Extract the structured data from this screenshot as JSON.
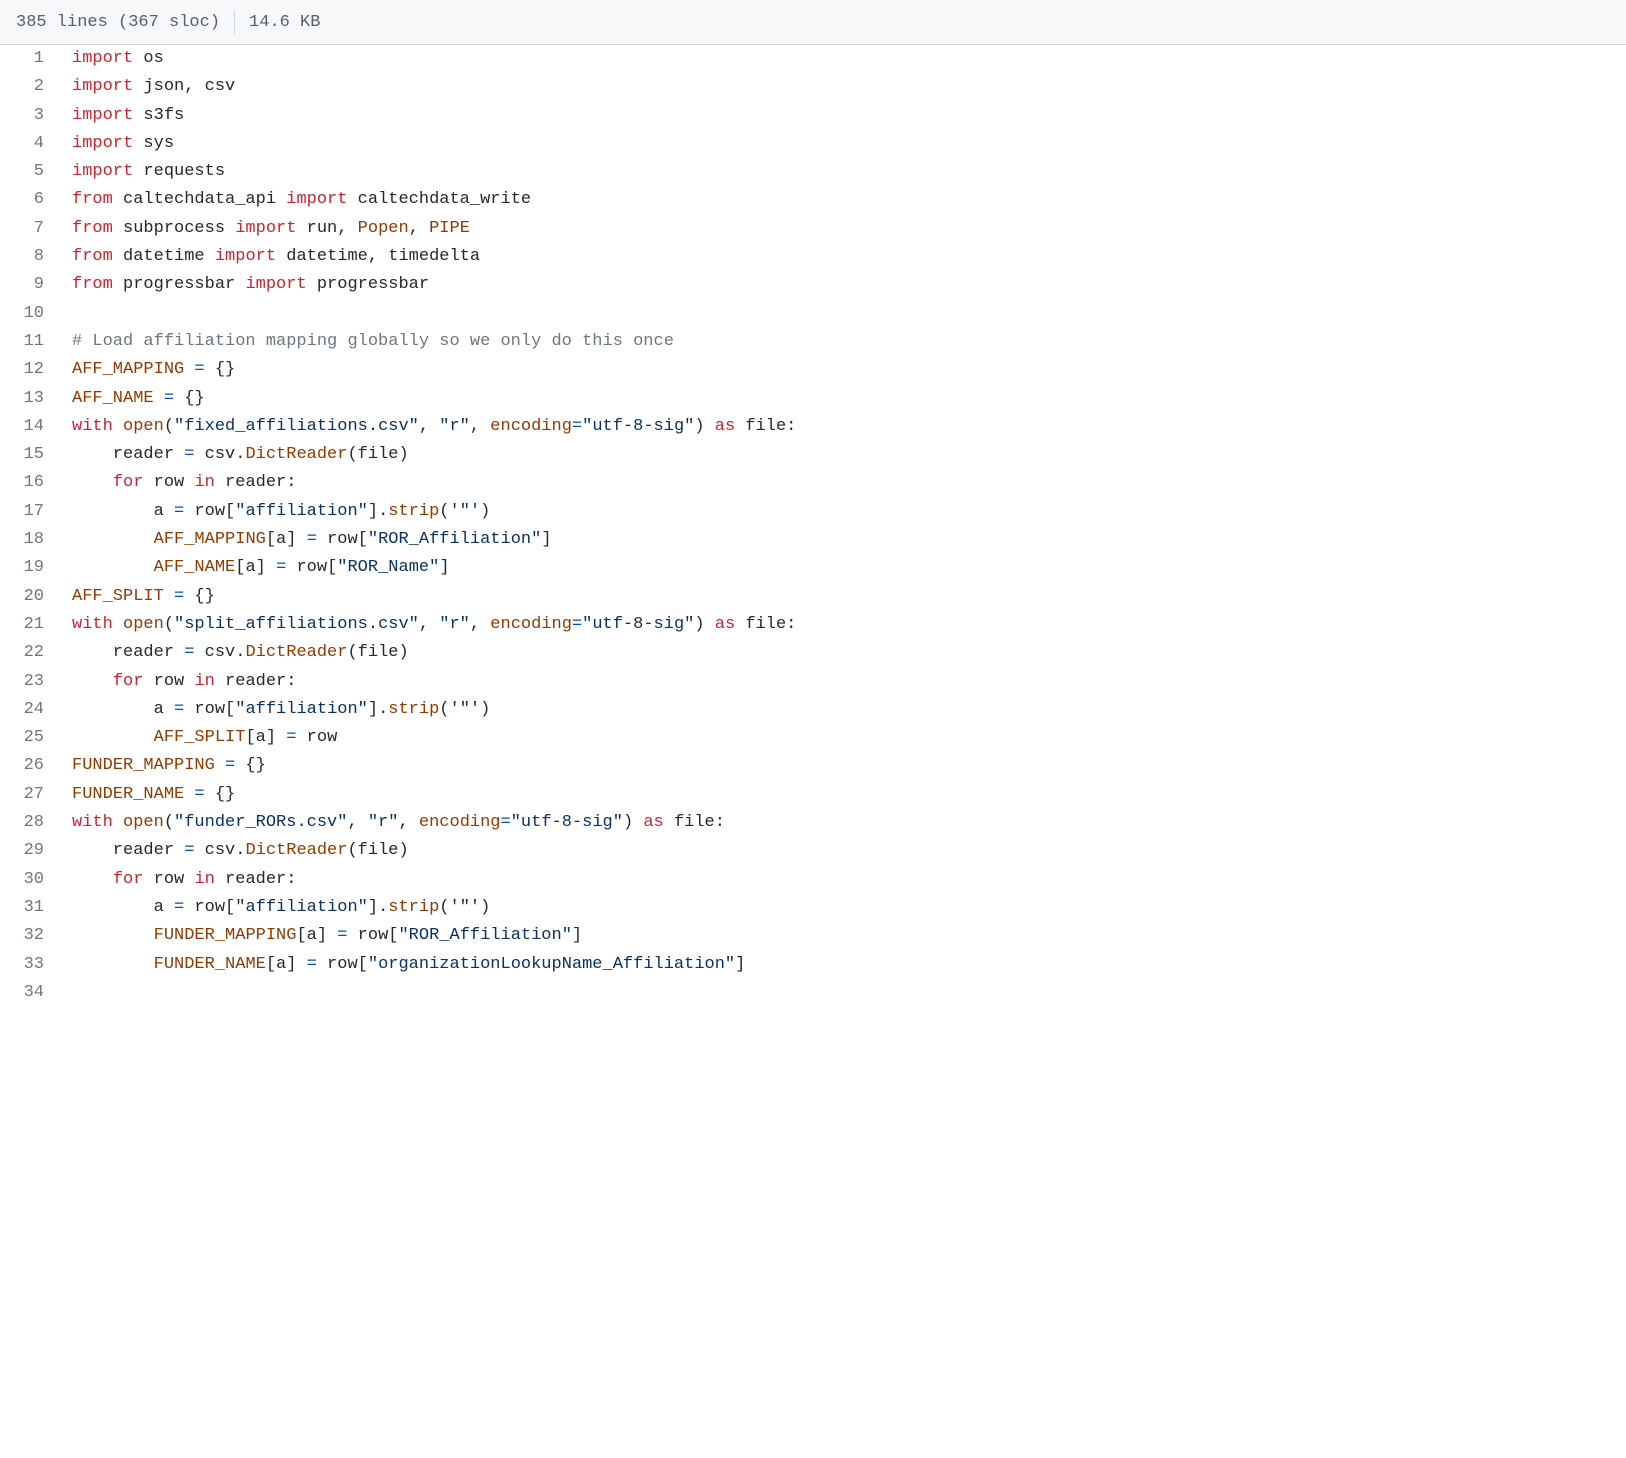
{
  "header": {
    "lines": "385 lines (367 sloc)",
    "size": "14.6 KB"
  },
  "code": [
    {
      "n": 1,
      "t": [
        [
          "kw",
          "import"
        ],
        [
          "nm",
          " os"
        ]
      ]
    },
    {
      "n": 2,
      "t": [
        [
          "kw",
          "import"
        ],
        [
          "nm",
          " json, csv"
        ]
      ]
    },
    {
      "n": 3,
      "t": [
        [
          "kw",
          "import"
        ],
        [
          "nm",
          " s3fs"
        ]
      ]
    },
    {
      "n": 4,
      "t": [
        [
          "kw",
          "import"
        ],
        [
          "nm",
          " sys"
        ]
      ]
    },
    {
      "n": 5,
      "t": [
        [
          "kw",
          "import"
        ],
        [
          "nm",
          " requests"
        ]
      ]
    },
    {
      "n": 6,
      "t": [
        [
          "kw",
          "from"
        ],
        [
          "nm",
          " caltechdata_api "
        ],
        [
          "kw",
          "import"
        ],
        [
          "nm",
          " caltechdata_write"
        ]
      ]
    },
    {
      "n": 7,
      "t": [
        [
          "kw",
          "from"
        ],
        [
          "nm",
          " subprocess "
        ],
        [
          "kw",
          "import"
        ],
        [
          "nm",
          " run, "
        ],
        [
          "var",
          "Popen"
        ],
        [
          "nm",
          ", "
        ],
        [
          "var",
          "PIPE"
        ]
      ]
    },
    {
      "n": 8,
      "t": [
        [
          "kw",
          "from"
        ],
        [
          "nm",
          " datetime "
        ],
        [
          "kw",
          "import"
        ],
        [
          "nm",
          " datetime, timedelta"
        ]
      ]
    },
    {
      "n": 9,
      "t": [
        [
          "kw",
          "from"
        ],
        [
          "nm",
          " progressbar "
        ],
        [
          "kw",
          "import"
        ],
        [
          "nm",
          " progressbar"
        ]
      ]
    },
    {
      "n": 10,
      "t": []
    },
    {
      "n": 11,
      "t": [
        [
          "cm",
          "# Load affiliation mapping globally so we only do this once"
        ]
      ]
    },
    {
      "n": 12,
      "t": [
        [
          "var",
          "AFF_MAPPING"
        ],
        [
          "nm",
          " "
        ],
        [
          "op-blue",
          "="
        ],
        [
          "nm",
          " {}"
        ]
      ]
    },
    {
      "n": 13,
      "t": [
        [
          "var",
          "AFF_NAME"
        ],
        [
          "nm",
          " "
        ],
        [
          "op-blue",
          "="
        ],
        [
          "nm",
          " {}"
        ]
      ]
    },
    {
      "n": 14,
      "t": [
        [
          "kw",
          "with"
        ],
        [
          "nm",
          " "
        ],
        [
          "fn",
          "open"
        ],
        [
          "nm",
          "("
        ],
        [
          "str",
          "\"fixed_affiliations.csv\""
        ],
        [
          "nm",
          ", "
        ],
        [
          "str",
          "\"r\""
        ],
        [
          "nm",
          ", "
        ],
        [
          "var",
          "encoding"
        ],
        [
          "op-blue",
          "="
        ],
        [
          "str",
          "\"utf-8-sig\""
        ],
        [
          "nm",
          ") "
        ],
        [
          "kw",
          "as"
        ],
        [
          "nm",
          " file:"
        ]
      ]
    },
    {
      "n": 15,
      "t": [
        [
          "nm",
          "    reader "
        ],
        [
          "op-blue",
          "="
        ],
        [
          "nm",
          " csv."
        ],
        [
          "fn",
          "DictReader"
        ],
        [
          "nm",
          "(file)"
        ]
      ]
    },
    {
      "n": 16,
      "t": [
        [
          "nm",
          "    "
        ],
        [
          "kw",
          "for"
        ],
        [
          "nm",
          " row "
        ],
        [
          "kw",
          "in"
        ],
        [
          "nm",
          " reader:"
        ]
      ]
    },
    {
      "n": 17,
      "t": [
        [
          "nm",
          "        a "
        ],
        [
          "op-blue",
          "="
        ],
        [
          "nm",
          " row["
        ],
        [
          "str",
          "\"affiliation\""
        ],
        [
          "nm",
          "]."
        ],
        [
          "fn",
          "strip"
        ],
        [
          "nm",
          "("
        ],
        [
          "str",
          "'\"'"
        ],
        [
          "nm",
          ")"
        ]
      ]
    },
    {
      "n": 18,
      "t": [
        [
          "nm",
          "        "
        ],
        [
          "var",
          "AFF_MAPPING"
        ],
        [
          "nm",
          "[a] "
        ],
        [
          "op-blue",
          "="
        ],
        [
          "nm",
          " row["
        ],
        [
          "str",
          "\"ROR_Affiliation\""
        ],
        [
          "nm",
          "]"
        ]
      ]
    },
    {
      "n": 19,
      "t": [
        [
          "nm",
          "        "
        ],
        [
          "var",
          "AFF_NAME"
        ],
        [
          "nm",
          "[a] "
        ],
        [
          "op-blue",
          "="
        ],
        [
          "nm",
          " row["
        ],
        [
          "str",
          "\"ROR_Name\""
        ],
        [
          "nm",
          "]"
        ]
      ]
    },
    {
      "n": 20,
      "t": [
        [
          "var",
          "AFF_SPLIT"
        ],
        [
          "nm",
          " "
        ],
        [
          "op-blue",
          "="
        ],
        [
          "nm",
          " {}"
        ]
      ]
    },
    {
      "n": 21,
      "t": [
        [
          "kw",
          "with"
        ],
        [
          "nm",
          " "
        ],
        [
          "fn",
          "open"
        ],
        [
          "nm",
          "("
        ],
        [
          "str",
          "\"split_affiliations.csv\""
        ],
        [
          "nm",
          ", "
        ],
        [
          "str",
          "\"r\""
        ],
        [
          "nm",
          ", "
        ],
        [
          "var",
          "encoding"
        ],
        [
          "op-blue",
          "="
        ],
        [
          "str",
          "\"utf-8-sig\""
        ],
        [
          "nm",
          ") "
        ],
        [
          "kw",
          "as"
        ],
        [
          "nm",
          " file:"
        ]
      ]
    },
    {
      "n": 22,
      "t": [
        [
          "nm",
          "    reader "
        ],
        [
          "op-blue",
          "="
        ],
        [
          "nm",
          " csv."
        ],
        [
          "fn",
          "DictReader"
        ],
        [
          "nm",
          "(file)"
        ]
      ]
    },
    {
      "n": 23,
      "t": [
        [
          "nm",
          "    "
        ],
        [
          "kw",
          "for"
        ],
        [
          "nm",
          " row "
        ],
        [
          "kw",
          "in"
        ],
        [
          "nm",
          " reader:"
        ]
      ]
    },
    {
      "n": 24,
      "t": [
        [
          "nm",
          "        a "
        ],
        [
          "op-blue",
          "="
        ],
        [
          "nm",
          " row["
        ],
        [
          "str",
          "\"affiliation\""
        ],
        [
          "nm",
          "]."
        ],
        [
          "fn",
          "strip"
        ],
        [
          "nm",
          "("
        ],
        [
          "str",
          "'\"'"
        ],
        [
          "nm",
          ")"
        ]
      ]
    },
    {
      "n": 25,
      "t": [
        [
          "nm",
          "        "
        ],
        [
          "var",
          "AFF_SPLIT"
        ],
        [
          "nm",
          "[a] "
        ],
        [
          "op-blue",
          "="
        ],
        [
          "nm",
          " row"
        ]
      ]
    },
    {
      "n": 26,
      "t": [
        [
          "var",
          "FUNDER_MAPPING"
        ],
        [
          "nm",
          " "
        ],
        [
          "op-blue",
          "="
        ],
        [
          "nm",
          " {}"
        ]
      ]
    },
    {
      "n": 27,
      "t": [
        [
          "var",
          "FUNDER_NAME"
        ],
        [
          "nm",
          " "
        ],
        [
          "op-blue",
          "="
        ],
        [
          "nm",
          " {}"
        ]
      ]
    },
    {
      "n": 28,
      "t": [
        [
          "kw",
          "with"
        ],
        [
          "nm",
          " "
        ],
        [
          "fn",
          "open"
        ],
        [
          "nm",
          "("
        ],
        [
          "str",
          "\"funder_RORs.csv\""
        ],
        [
          "nm",
          ", "
        ],
        [
          "str",
          "\"r\""
        ],
        [
          "nm",
          ", "
        ],
        [
          "var",
          "encoding"
        ],
        [
          "op-blue",
          "="
        ],
        [
          "str",
          "\"utf-8-sig\""
        ],
        [
          "nm",
          ") "
        ],
        [
          "kw",
          "as"
        ],
        [
          "nm",
          " file:"
        ]
      ]
    },
    {
      "n": 29,
      "t": [
        [
          "nm",
          "    reader "
        ],
        [
          "op-blue",
          "="
        ],
        [
          "nm",
          " csv."
        ],
        [
          "fn",
          "DictReader"
        ],
        [
          "nm",
          "(file)"
        ]
      ]
    },
    {
      "n": 30,
      "t": [
        [
          "nm",
          "    "
        ],
        [
          "kw",
          "for"
        ],
        [
          "nm",
          " row "
        ],
        [
          "kw",
          "in"
        ],
        [
          "nm",
          " reader:"
        ]
      ]
    },
    {
      "n": 31,
      "t": [
        [
          "nm",
          "        a "
        ],
        [
          "op-blue",
          "="
        ],
        [
          "nm",
          " row["
        ],
        [
          "str",
          "\"affiliation\""
        ],
        [
          "nm",
          "]."
        ],
        [
          "fn",
          "strip"
        ],
        [
          "nm",
          "("
        ],
        [
          "str",
          "'\"'"
        ],
        [
          "nm",
          ")"
        ]
      ]
    },
    {
      "n": 32,
      "t": [
        [
          "nm",
          "        "
        ],
        [
          "var",
          "FUNDER_MAPPING"
        ],
        [
          "nm",
          "[a] "
        ],
        [
          "op-blue",
          "="
        ],
        [
          "nm",
          " row["
        ],
        [
          "str",
          "\"ROR_Affiliation\""
        ],
        [
          "nm",
          "]"
        ]
      ]
    },
    {
      "n": 33,
      "t": [
        [
          "nm",
          "        "
        ],
        [
          "var",
          "FUNDER_NAME"
        ],
        [
          "nm",
          "[a] "
        ],
        [
          "op-blue",
          "="
        ],
        [
          "nm",
          " row["
        ],
        [
          "str",
          "\"organizationLookupName_Affiliation\""
        ],
        [
          "nm",
          "]"
        ]
      ]
    },
    {
      "n": 34,
      "t": []
    }
  ]
}
